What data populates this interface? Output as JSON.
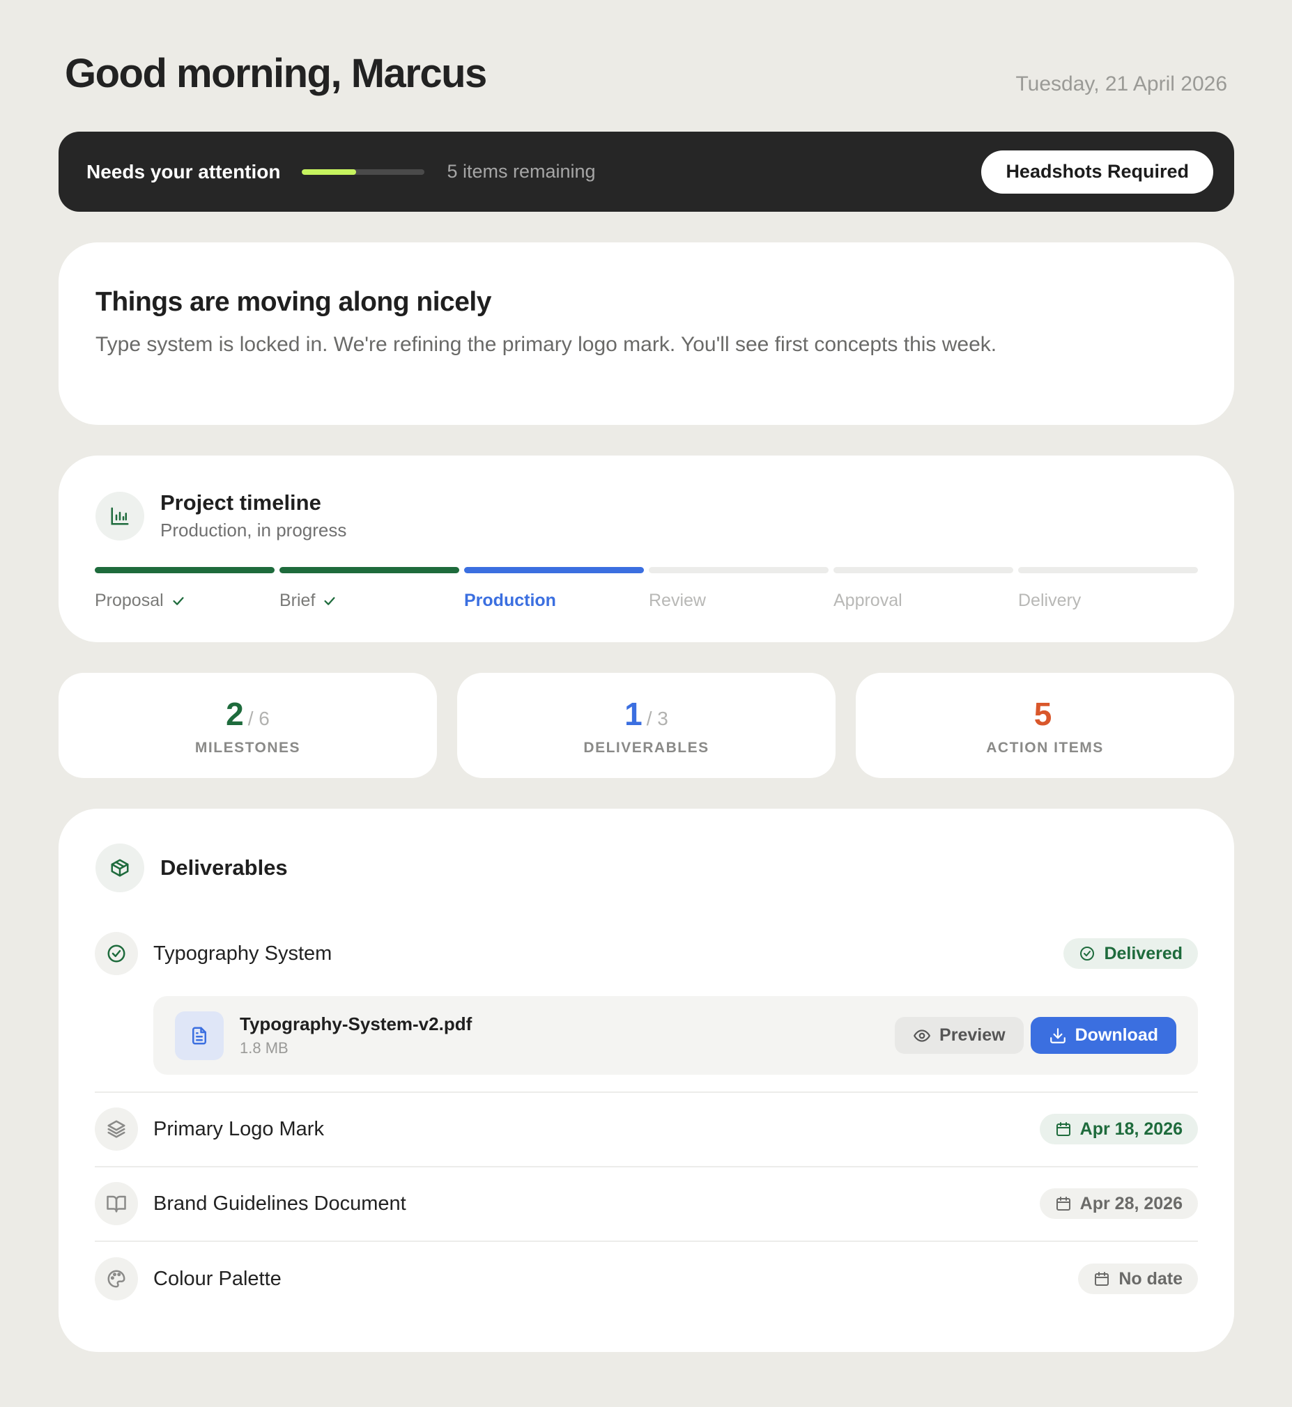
{
  "header": {
    "greeting": "Good morning, Marcus",
    "date": "Tuesday, 21 April 2026"
  },
  "attention": {
    "title": "Needs your attention",
    "progress_fraction": 0.44,
    "remaining": "5 items remaining",
    "action_label": "Headshots Required"
  },
  "status": {
    "title": "Things are moving along nicely",
    "text": "Type system is locked in. We're refining the primary logo mark. You'll see first concepts this week."
  },
  "timeline": {
    "icon": "bar-chart-icon",
    "title": "Project timeline",
    "subtitle": "Production, in progress",
    "stages": [
      {
        "label": "Proposal",
        "state": "done"
      },
      {
        "label": "Brief",
        "state": "done"
      },
      {
        "label": "Production",
        "state": "current"
      },
      {
        "label": "Review",
        "state": "upcoming"
      },
      {
        "label": "Approval",
        "state": "upcoming"
      },
      {
        "label": "Delivery",
        "state": "upcoming"
      }
    ]
  },
  "stats": [
    {
      "value": "2",
      "total": "/ 6",
      "label": "MILESTONES",
      "color": "#1e6b3c"
    },
    {
      "value": "1",
      "total": "/ 3",
      "label": "DELIVERABLES",
      "color": "#3b6fe0"
    },
    {
      "value": "5",
      "total": "",
      "label": "ACTION ITEMS",
      "color": "#d9572b"
    }
  ],
  "deliverables": {
    "title": "Deliverables",
    "icon": "package-icon",
    "items": [
      {
        "title": "Typography System",
        "icon": "check-circle-icon",
        "status": "Delivered",
        "status_icon": "check-circle-icon"
      },
      {
        "title": "Primary Logo Mark",
        "icon": "layers-icon",
        "status": "Apr 18, 2026",
        "status_icon": "calendar-icon"
      },
      {
        "title": "Brand Guidelines Document",
        "icon": "book-icon",
        "status": "Apr 28, 2026",
        "status_icon": "calendar-icon"
      },
      {
        "title": "Colour Palette",
        "icon": "palette-icon",
        "status": "No date",
        "status_icon": "calendar-icon"
      }
    ],
    "file": {
      "name": "Typography-System-v2.pdf",
      "size": "1.8 MB",
      "icon": "file-text-icon",
      "preview_label": "Preview",
      "download_label": "Download"
    }
  },
  "colors": {
    "done": "#1e6b3c",
    "current": "#3b6fe0",
    "upcoming": "#ececea",
    "accent_lime": "#c6f35f",
    "action_orange": "#d9572b"
  }
}
